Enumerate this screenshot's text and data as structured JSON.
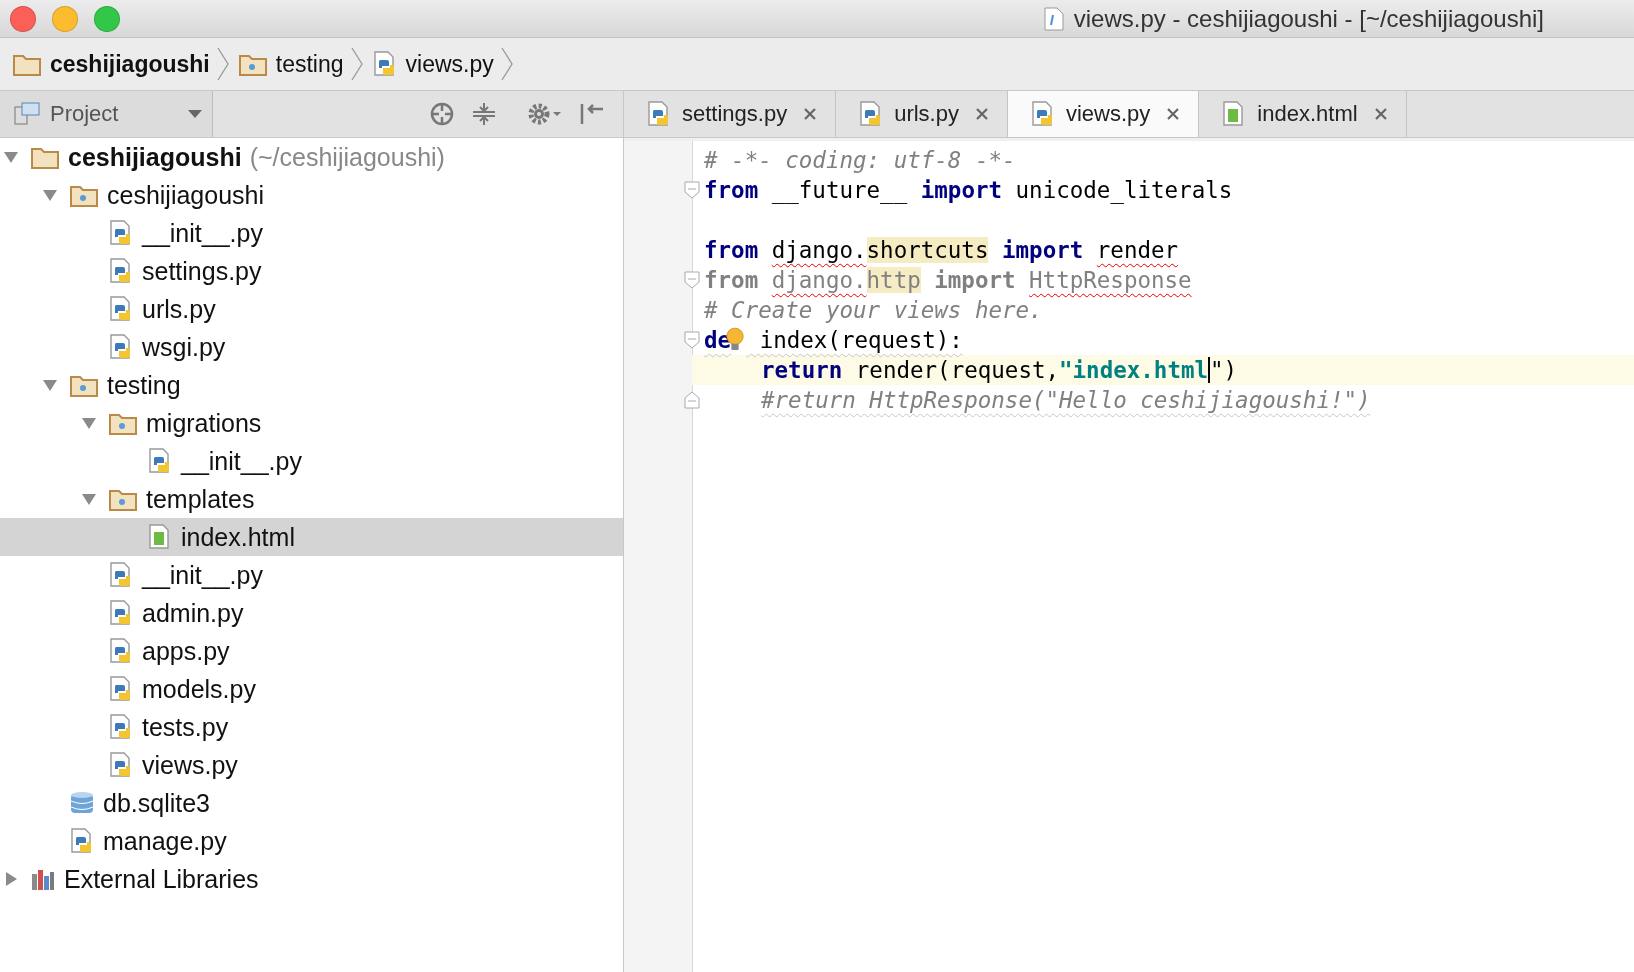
{
  "window": {
    "title": "views.py - ceshijiagoushi - [~/ceshijiagoushi]"
  },
  "breadcrumbs": [
    {
      "label": "ceshijiagoushi",
      "kind": "folder"
    },
    {
      "label": "testing",
      "kind": "package"
    },
    {
      "label": "views.py",
      "kind": "python"
    }
  ],
  "project_panel": {
    "title": "Project"
  },
  "tabs": [
    {
      "label": "settings.py",
      "kind": "python",
      "selected": false
    },
    {
      "label": "urls.py",
      "kind": "python",
      "selected": false
    },
    {
      "label": "views.py",
      "kind": "python",
      "selected": true
    },
    {
      "label": "index.html",
      "kind": "html",
      "selected": false
    }
  ],
  "tree": [
    {
      "label": "ceshijiagoushi",
      "path": "(~/ceshijiagoushi)",
      "kind": "folder",
      "expanded": true,
      "selected": false,
      "children": [
        {
          "label": "ceshijiagoushi",
          "kind": "package",
          "expanded": true,
          "selected": false,
          "children": [
            {
              "label": "__init__.py",
              "kind": "python",
              "selected": false
            },
            {
              "label": "settings.py",
              "kind": "python",
              "selected": false
            },
            {
              "label": "urls.py",
              "kind": "python",
              "selected": false
            },
            {
              "label": "wsgi.py",
              "kind": "python",
              "selected": false
            }
          ]
        },
        {
          "label": "testing",
          "kind": "package",
          "expanded": true,
          "selected": false,
          "children": [
            {
              "label": "migrations",
              "kind": "package",
              "expanded": true,
              "selected": false,
              "children": [
                {
                  "label": "__init__.py",
                  "kind": "python",
                  "selected": false
                }
              ]
            },
            {
              "label": "templates",
              "kind": "package",
              "expanded": true,
              "selected": false,
              "children": [
                {
                  "label": "index.html",
                  "kind": "html",
                  "selected": true
                }
              ]
            },
            {
              "label": "__init__.py",
              "kind": "python",
              "selected": false
            },
            {
              "label": "admin.py",
              "kind": "python",
              "selected": false
            },
            {
              "label": "apps.py",
              "kind": "python",
              "selected": false
            },
            {
              "label": "models.py",
              "kind": "python",
              "selected": false
            },
            {
              "label": "tests.py",
              "kind": "python",
              "selected": false
            },
            {
              "label": "views.py",
              "kind": "python",
              "selected": false
            }
          ]
        },
        {
          "label": "db.sqlite3",
          "kind": "database",
          "selected": false
        },
        {
          "label": "manage.py",
          "kind": "python",
          "selected": false
        }
      ]
    },
    {
      "label": "External Libraries",
      "kind": "library",
      "expanded": false,
      "selected": false
    }
  ],
  "code": [
    {
      "kind": "plain",
      "current": false,
      "tokens": [
        {
          "kind": "comment",
          "text": "# -*- coding: utf-8 -*-"
        }
      ]
    },
    {
      "kind": "fold-start",
      "current": false,
      "tokens": [
        {
          "kind": "keyword",
          "text": "from"
        },
        {
          "kind": "text",
          "text": " __future__ "
        },
        {
          "kind": "keyword",
          "text": "import"
        },
        {
          "kind": "text",
          "text": " unicode_literals"
        }
      ]
    },
    {
      "kind": "plain",
      "current": false
    },
    {
      "kind": "plain",
      "current": false,
      "tokens": [
        {
          "kind": "keyword",
          "text": "from"
        },
        {
          "kind": "error",
          "spaced": true,
          "text": "django."
        },
        {
          "kind": "highlight",
          "text": "shortcuts"
        },
        {
          "kind": "keyword",
          "spaced": true,
          "text": "import"
        },
        {
          "kind": "error",
          "spaced": true,
          "text": "render"
        }
      ]
    },
    {
      "kind": "fold-start",
      "current": false,
      "tokens": [
        {
          "kind": "unused-keyword",
          "text": "from"
        },
        {
          "kind": "unused-error",
          "spaced": true,
          "text": "django."
        },
        {
          "kind": "unused-highlight",
          "text": "http"
        },
        {
          "kind": "unused-keyword",
          "spaced": true,
          "text": "import"
        },
        {
          "kind": "unused-error",
          "spaced": true,
          "text": "HttpResponse"
        }
      ]
    },
    {
      "kind": "plain",
      "current": false,
      "tokens": [
        {
          "kind": "comment",
          "text": "# Create your views here."
        }
      ]
    },
    {
      "kind": "fold-start",
      "current": false,
      "bulb": true,
      "tokens": [
        {
          "kind": "keyword-weak",
          "text": "de"
        },
        {
          "kind": "weak",
          "text": " index(request):"
        }
      ]
    },
    {
      "kind": "plain",
      "current": true,
      "indented": true,
      "tokens": [
        {
          "kind": "keyword",
          "text": "return"
        },
        {
          "kind": "text",
          "text": " render(request,"
        },
        {
          "kind": "string-caret",
          "text": "\"index.html"
        },
        {
          "kind": "text",
          "text": "\")"
        }
      ]
    },
    {
      "kind": "fold-end",
      "current": false,
      "indented": true,
      "tokens": [
        {
          "kind": "comment-weak",
          "text": "#return HttpResponse(\"Hello ceshijiagoushi!\")"
        }
      ]
    }
  ]
}
